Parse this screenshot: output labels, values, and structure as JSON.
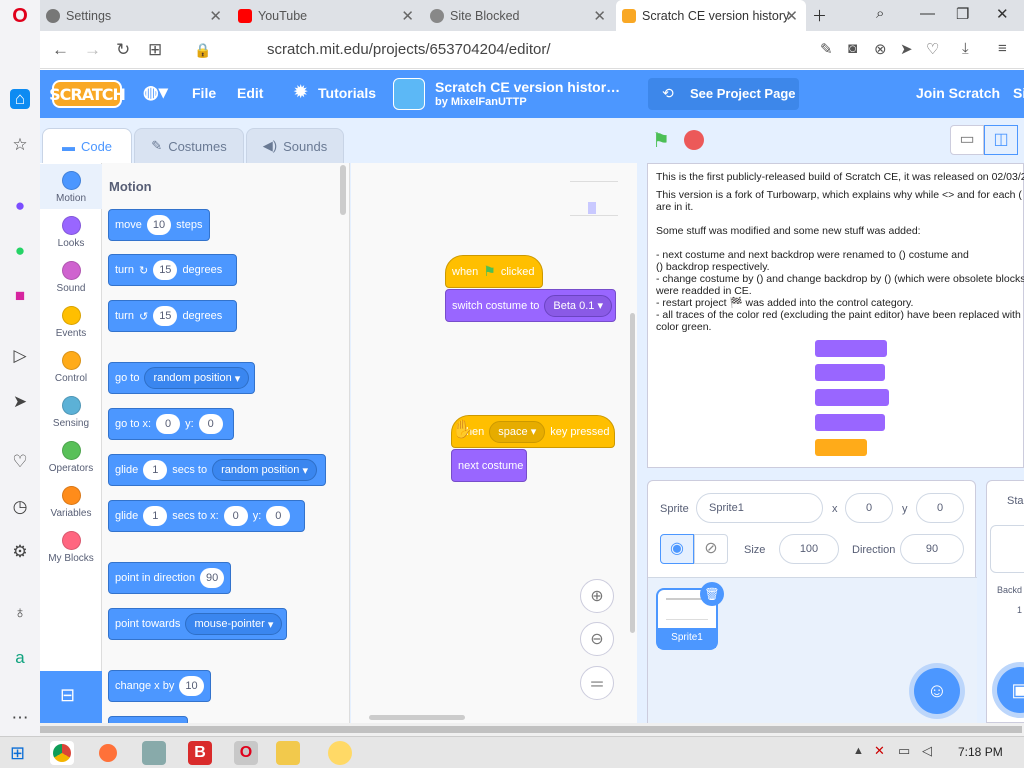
{
  "browser": {
    "tabs": [
      {
        "label": "Settings",
        "icon": "gear-icon"
      },
      {
        "label": "YouTube",
        "icon": "youtube-icon"
      },
      {
        "label": "Site Blocked",
        "icon": "globe-icon"
      },
      {
        "label": "Scratch CE version history",
        "icon": "scratch-icon"
      }
    ],
    "url": "scratch.mit.edu/projects/653704204/editor/"
  },
  "menu": {
    "logo": "SCRATCH",
    "file": "File",
    "edit": "Edit",
    "tutorials": "Tutorials",
    "project_title": "Scratch CE version histor…",
    "author": "by MixelFanUTTP",
    "see_project": "See Project Page",
    "join": "Join Scratch",
    "signin": "Si"
  },
  "editor_tabs": {
    "code": "Code",
    "costumes": "Costumes",
    "sounds": "Sounds"
  },
  "categories": [
    {
      "label": "Motion",
      "color": "#4c97ff"
    },
    {
      "label": "Looks",
      "color": "#9966ff"
    },
    {
      "label": "Sound",
      "color": "#cf63cf"
    },
    {
      "label": "Events",
      "color": "#ffbf00"
    },
    {
      "label": "Control",
      "color": "#ffab19"
    },
    {
      "label": "Sensing",
      "color": "#5cb1d6"
    },
    {
      "label": "Operators",
      "color": "#59c059"
    },
    {
      "label": "Variables",
      "color": "#ff8c1a"
    },
    {
      "label": "My Blocks",
      "color": "#ff6680"
    }
  ],
  "palette": {
    "heading": "Motion",
    "move": {
      "a": "move",
      "n": "10",
      "b": "steps"
    },
    "turn_right": {
      "a": "turn",
      "n": "15",
      "b": "degrees"
    },
    "turn_left": {
      "a": "turn",
      "n": "15",
      "b": "degrees"
    },
    "goto": {
      "a": "go to",
      "d": "random position"
    },
    "gotoxy": {
      "a": "go to x:",
      "x": "0",
      "b": "y:",
      "y": "0"
    },
    "glide": {
      "a": "glide",
      "n": "1",
      "b": "secs to",
      "d": "random position"
    },
    "glidexy": {
      "a": "glide",
      "n": "1",
      "b": "secs to x:",
      "x": "0",
      "c": "y:",
      "y": "0"
    },
    "point_dir": {
      "a": "point in direction",
      "n": "90"
    },
    "point_towards": {
      "a": "point towards",
      "d": "mouse-pointer"
    },
    "change_x": {
      "a": "change x by",
      "n": "10"
    }
  },
  "scripts": {
    "when_flag": {
      "a": "when",
      "b": "clicked"
    },
    "switch_costume": {
      "a": "switch costume to",
      "d": "Beta 0.1"
    },
    "when_key": {
      "a": "when",
      "d": "space",
      "b": "key pressed"
    },
    "next_costume": "next costume"
  },
  "stage_text": {
    "l1": "This is the first publicly-released build of Scratch CE, it was released on 02/03/2",
    "l2": "This version is a fork of Turbowarp, which explains why while <> and for each (",
    "l3": "are in it.",
    "l4": "Some stuff was modified and some new stuff was added:",
    "l5": "- next costume and next backdrop were renamed to () costume and",
    "l6": "() backdrop respectively.",
    "l7": "- change costume by () and change backdrop by () (which were obsolete blocks",
    "l8": "were readded in CE.",
    "l9": "- restart project 🏁 was added into the control category.",
    "l10": "- all traces of the color red (excluding the paint editor) have been replaced with",
    "l11": "color green."
  },
  "sprite": {
    "label": "Sprite",
    "name": "Sprite1",
    "x_label": "x",
    "x": "0",
    "y_label": "y",
    "y": "0",
    "size_label": "Size",
    "size": "100",
    "dir_label": "Direction",
    "dir": "90",
    "thumb_label": "Sprite1"
  },
  "stage_pane": {
    "label": "Stag",
    "backdrops": "Backd",
    "count": "1"
  },
  "taskbar": {
    "time": "7:18 PM"
  }
}
